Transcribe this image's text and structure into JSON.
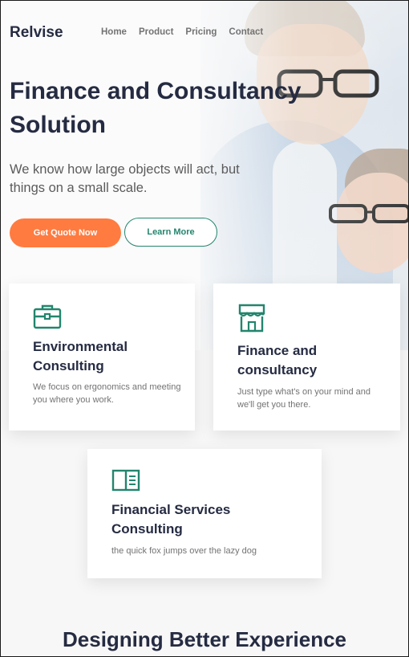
{
  "header": {
    "brand": "Relvise",
    "nav": [
      "Home",
      "Product",
      "Pricing",
      "Contact"
    ]
  },
  "hero": {
    "title": "Finance and Consultancy Solution",
    "subtitle": "We know how large objects will act, but things on a small scale.",
    "primary_button": "Get Quote Now",
    "secondary_button": "Learn More"
  },
  "services": [
    {
      "icon": "briefcase-icon",
      "title": "Environmental Consulting",
      "description": "We focus on ergonomics and meeting you where you work."
    },
    {
      "icon": "storefront-icon",
      "title": "Finance and consultancy",
      "description": "Just type what's on your mind and we'll get you there."
    },
    {
      "icon": "book-open-icon",
      "title": "Financial Services Consulting",
      "description": "the quick fox jumps over the lazy dog"
    }
  ],
  "section": {
    "title": "Designing Better Experience"
  },
  "colors": {
    "accent": "#ff7b40",
    "primary": "#23856d",
    "heading": "#252b42",
    "muted": "#737373"
  }
}
